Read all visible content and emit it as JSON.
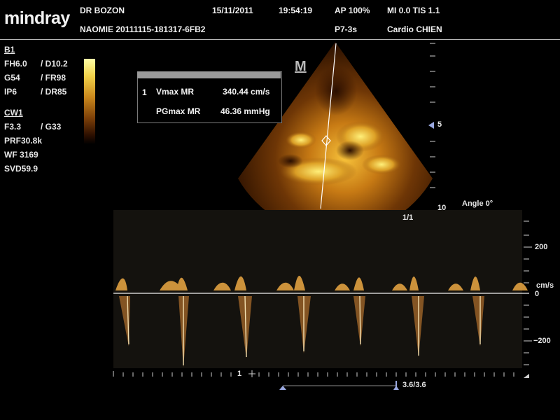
{
  "header": {
    "logo": "mindray",
    "doctor": "DR BOZON",
    "date": "15/11/2011",
    "time": "19:54:19",
    "power": "AP  100%",
    "indices": "MI 0.0 TIS 1.1",
    "patient": "NAOMIE 20111115-181317-6FB2",
    "probe": "P7-3s",
    "exam": "Cardio CHIEN"
  },
  "b_mode": {
    "label": "B1",
    "params": [
      {
        "left": "FH6.0",
        "right": "/ D10.2"
      },
      {
        "left": "G54",
        "right": "/ FR98"
      },
      {
        "left": "IP6",
        "right": "/ DR85"
      }
    ]
  },
  "cw_mode": {
    "label": "CW1",
    "params_pair": {
      "left": "F3.3",
      "right": "/ G33"
    },
    "prf": "PRF30.8k",
    "wf": "WF 3169",
    "svd": "SVD59.9"
  },
  "measurement": {
    "index": "1",
    "rows": [
      {
        "name": "Vmax MR",
        "value": "340.44 cm/s"
      },
      {
        "name": "PGmax MR",
        "value": "46.36 mmHg"
      }
    ]
  },
  "mmode_icon": "M",
  "depth_scale": {
    "mark_5": "5",
    "mark_10": "10"
  },
  "angle": "Angle 0°",
  "sweep_top": {
    "label": "1/1"
  },
  "sweep_bottom": {
    "label": "3.6/3.6"
  },
  "doppler_scale": {
    "tick_200": "200",
    "unit": "cm/s",
    "tick_0": "0",
    "tick_neg200": "−200"
  },
  "cursor_marker": "1",
  "colors": {
    "sector": "#c47a12",
    "highlight": "#ffe060",
    "scale_blue": "#9aa8e0"
  },
  "icons": [
    "colorbar",
    "sector-image",
    "cursor-line",
    "focus-marker",
    "depth-arrow",
    "sweep-marker"
  ]
}
